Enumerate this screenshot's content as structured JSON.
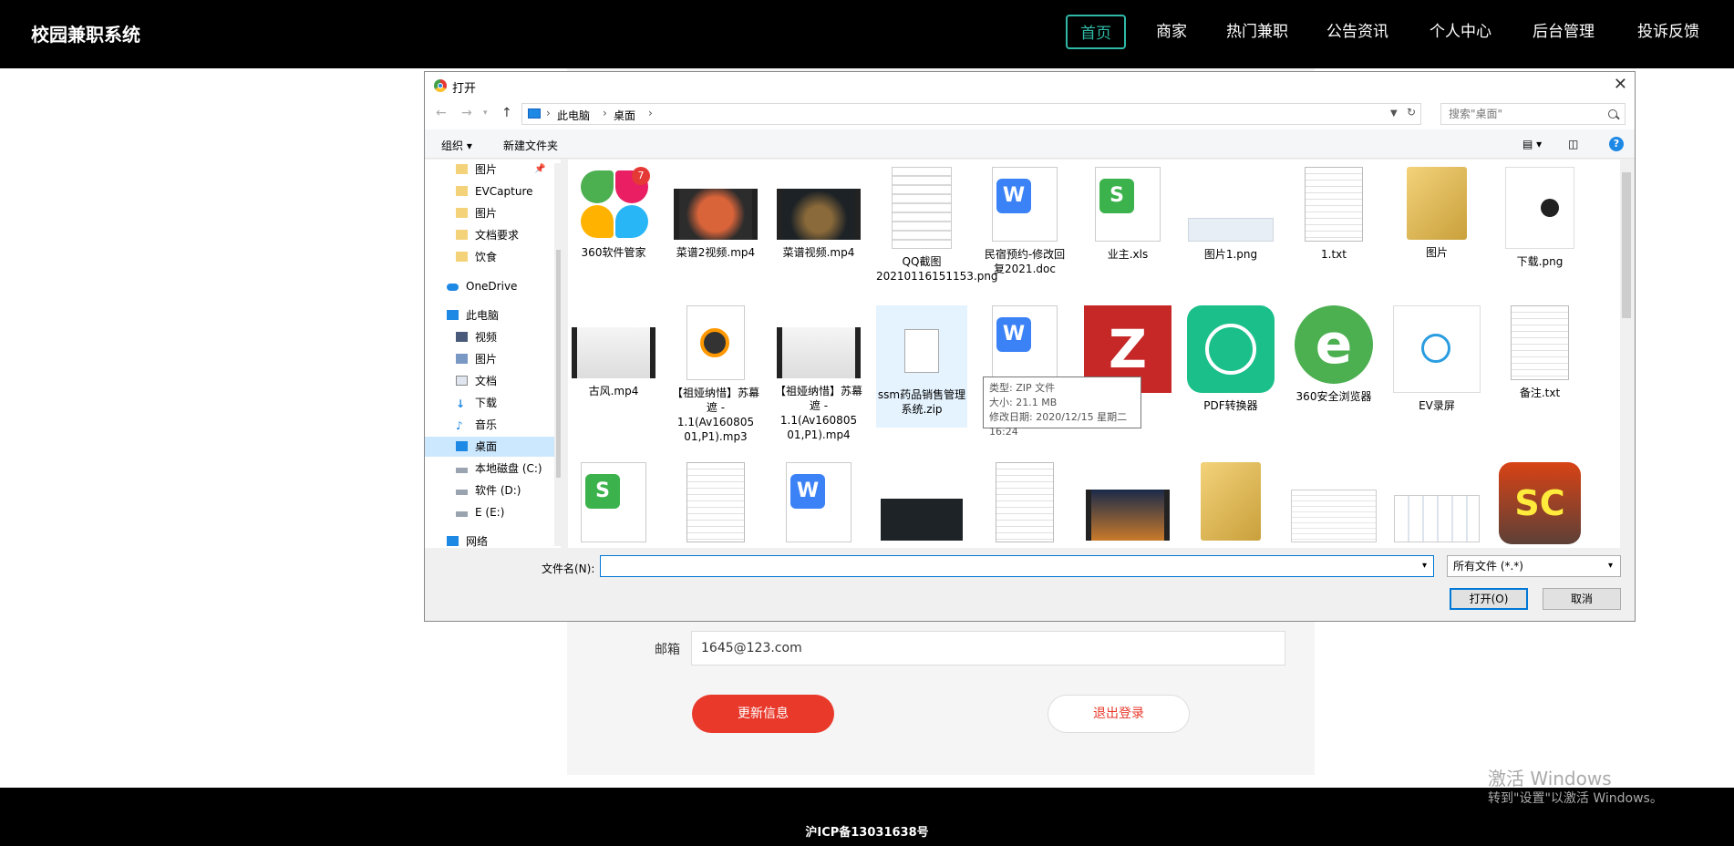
{
  "nav": {
    "brand": "校园兼职系统",
    "items": [
      "首页",
      "商家",
      "热门兼职",
      "公告资讯",
      "个人中心",
      "后台管理",
      "投诉反馈"
    ]
  },
  "profile": {
    "email_label": "邮箱",
    "email_value": "1645@123.com",
    "update_button": "更新信息",
    "logout_button": "退出登录"
  },
  "watermark": {
    "line1": "激活 Windows",
    "line2": "转到\"设置\"以激活 Windows。"
  },
  "footer": {
    "text": "沪ICP备13031638号"
  },
  "dialog": {
    "title": "打开",
    "breadcrumb": [
      "此电脑",
      "桌面"
    ],
    "search_placeholder": "搜索\"桌面\"",
    "toolbar": {
      "organize": "组织 ▾",
      "new_folder": "新建文件夹",
      "help": "?"
    },
    "sidebar": [
      {
        "label": "图片",
        "icon": "folder-icon",
        "pinned": true
      },
      {
        "label": "EVCapture",
        "icon": "folder-icon"
      },
      {
        "label": "图片",
        "icon": "folder-icon"
      },
      {
        "label": "文档要求",
        "icon": "folder-icon"
      },
      {
        "label": "饮食",
        "icon": "folder-icon"
      },
      {
        "label": "OneDrive",
        "icon": "cloud-icon"
      },
      {
        "label": "此电脑",
        "icon": "computer-icon"
      },
      {
        "label": "视频",
        "icon": "video-folder-icon"
      },
      {
        "label": "图片",
        "icon": "picture-folder-icon"
      },
      {
        "label": "文档",
        "icon": "document-folder-icon"
      },
      {
        "label": "下载",
        "icon": "download-icon"
      },
      {
        "label": "音乐",
        "icon": "music-icon"
      },
      {
        "label": "桌面",
        "icon": "desktop-icon",
        "selected": true
      },
      {
        "label": "本地磁盘 (C:)",
        "icon": "drive-icon"
      },
      {
        "label": "软件 (D:)",
        "icon": "drive-icon"
      },
      {
        "label": "E (E:)",
        "icon": "drive-icon"
      },
      {
        "label": "网络",
        "icon": "network-icon"
      }
    ],
    "files": [
      {
        "name": "360软件管家",
        "icon": "app-360-icon",
        "badge": "7"
      },
      {
        "name": "菜谱2视频.mp4",
        "icon": "video-food-thumbnail"
      },
      {
        "name": "菜谱视频.mp4",
        "icon": "video-dark-thumbnail"
      },
      {
        "name": "QQ截图20210116151153.png",
        "icon": "screenshot-thumbnail"
      },
      {
        "name": "民宿预约-修改回复2021.doc",
        "icon": "word-doc-icon"
      },
      {
        "name": "业主.xls",
        "icon": "excel-icon"
      },
      {
        "name": "图片1.png",
        "icon": "image-thumbnail"
      },
      {
        "name": "1.txt",
        "icon": "text-file-icon"
      },
      {
        "name": "图片",
        "icon": "folder-shortcut-icon"
      },
      {
        "name": "下载.png",
        "icon": "panda-image-thumbnail"
      },
      {
        "name": "古风.mp4",
        "icon": "video-ink-thumbnail"
      },
      {
        "name": "【祖娅纳惜】苏幕遮 - 1.1(Av160805 01,P1).mp3",
        "icon": "music-file-icon"
      },
      {
        "name": "【祖娅纳惜】苏幕遮 - 1.1(Av160805 01,P1).mp4",
        "icon": "video-ink-thumbnail"
      },
      {
        "name": "ssm药品销售管理系统.zip",
        "icon": "zip-file-icon",
        "selected": true
      },
      {
        "name": "",
        "icon": "word-doc-icon"
      },
      {
        "name": "",
        "icon": "filezilla-icon"
      },
      {
        "name": "PDF转换器",
        "icon": "pdf-converter-icon"
      },
      {
        "name": "360安全浏览器",
        "icon": "browser-360-icon"
      },
      {
        "name": "EV录屏",
        "icon": "ev-recorder-icon"
      },
      {
        "name": "备注.txt",
        "icon": "text-file-icon"
      },
      {
        "name": "",
        "icon": "excel-icon"
      },
      {
        "name": "",
        "icon": "text-file-icon"
      },
      {
        "name": "",
        "icon": "word-doc-icon"
      },
      {
        "name": "",
        "icon": "dark-screenshot-thumbnail"
      },
      {
        "name": "",
        "icon": "text-file-icon"
      },
      {
        "name": "",
        "icon": "city-video-thumbnail"
      },
      {
        "name": "",
        "icon": "folder-shortcut-icon"
      },
      {
        "name": "",
        "icon": "document-screenshot-thumbnail"
      },
      {
        "name": "",
        "icon": "screenshot-thumbnail"
      },
      {
        "name": "",
        "icon": "sc-game-icon"
      }
    ],
    "tooltip": {
      "type_label": "类型:",
      "type": "ZIP 文件",
      "size_label": "大小:",
      "size": "21.1 MB",
      "date_label": "修改日期:",
      "date": "2020/12/15 星期二 16:24"
    },
    "filename_label": "文件名(N):",
    "filename_value": "",
    "filetype_value": "所有文件 (*.*)",
    "open_button": "打开(O)",
    "cancel_button": "取消"
  }
}
